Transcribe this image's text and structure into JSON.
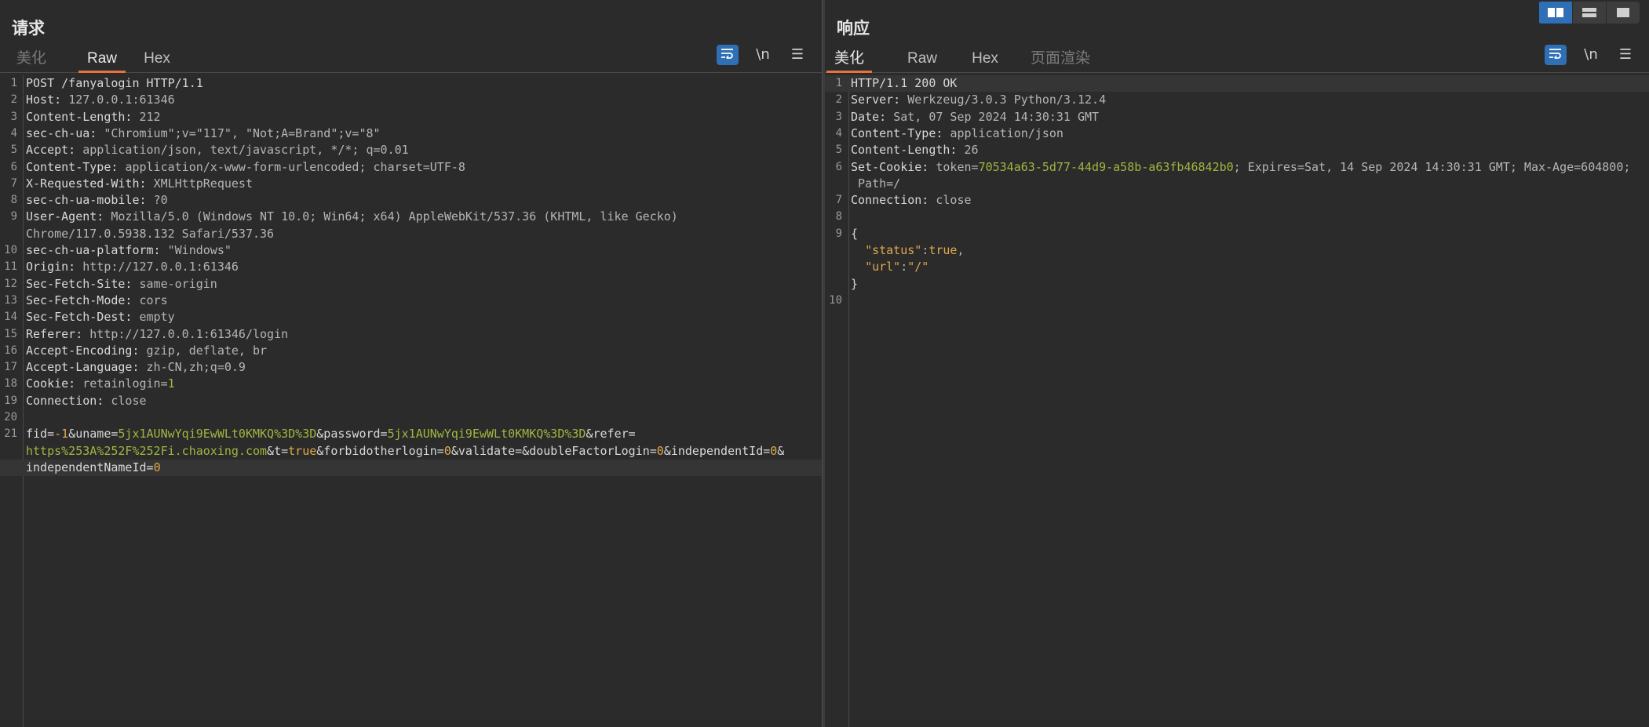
{
  "request": {
    "title": "请求",
    "tabs": [
      "美化",
      "Raw",
      "Hex"
    ],
    "active_tab": "Raw",
    "tools": {
      "wrap_icon": "wrap-icon",
      "newline_label": "\\n",
      "menu_icon": "menu-icon"
    },
    "lines": [
      {
        "n": "1",
        "k": "POST /fanyalogin HTTP/1.1"
      },
      {
        "n": "2",
        "k": "Host: ",
        "v": "127.0.0.1:61346"
      },
      {
        "n": "3",
        "k": "Content-Length: ",
        "v": "212"
      },
      {
        "n": "4",
        "k": "sec-ch-ua: ",
        "v": "\"Chromium\";v=\"117\", \"Not;A=Brand\";v=\"8\""
      },
      {
        "n": "5",
        "k": "Accept: ",
        "v": "application/json, text/javascript, */*; q=0.01"
      },
      {
        "n": "6",
        "k": "Content-Type: ",
        "v": "application/x-www-form-urlencoded; charset=UTF-8"
      },
      {
        "n": "7",
        "k": "X-Requested-With: ",
        "v": "XMLHttpRequest"
      },
      {
        "n": "8",
        "k": "sec-ch-ua-mobile: ",
        "v": "?0"
      },
      {
        "n": "9",
        "k": "User-Agent: ",
        "v": "Mozilla/5.0 (Windows NT 10.0; Win64; x64) AppleWebKit/537.36 (KHTML, like Gecko)"
      },
      {
        "n": "",
        "v": "Chrome/117.0.5938.132 Safari/537.36"
      },
      {
        "n": "10",
        "k": "sec-ch-ua-platform: ",
        "v": "\"Windows\""
      },
      {
        "n": "11",
        "k": "Origin: ",
        "v": "http://127.0.0.1:61346"
      },
      {
        "n": "12",
        "k": "Sec-Fetch-Site: ",
        "v": "same-origin"
      },
      {
        "n": "13",
        "k": "Sec-Fetch-Mode: ",
        "v": "cors"
      },
      {
        "n": "14",
        "k": "Sec-Fetch-Dest: ",
        "v": "empty"
      },
      {
        "n": "15",
        "k": "Referer: ",
        "v": "http://127.0.0.1:61346/login"
      },
      {
        "n": "16",
        "k": "Accept-Encoding: ",
        "v": "gzip, deflate, br"
      },
      {
        "n": "17",
        "k": "Accept-Language: ",
        "v": "zh-CN,zh;q=0.9"
      },
      {
        "n": "18",
        "k": "Cookie: ",
        "v": "retainlogin=",
        "g": "1"
      },
      {
        "n": "19",
        "k": "Connection: ",
        "v": "close"
      },
      {
        "n": "20"
      },
      {
        "n": "21",
        "body": [
          [
            "k",
            "fid="
          ],
          [
            "o",
            "-1"
          ],
          [
            "k",
            "&uname="
          ],
          [
            "g",
            "5jx1AUNwYqi9EwWLt0KMKQ%3D%3D"
          ],
          [
            "k",
            "&password="
          ],
          [
            "g",
            "5jx1AUNwYqi9EwWLt0KMKQ%3D%3D"
          ],
          [
            "k",
            "&refer="
          ]
        ]
      },
      {
        "n": "",
        "body": [
          [
            "g",
            "https%253A%252F%252Fi.chaoxing.com"
          ],
          [
            "k",
            "&t="
          ],
          [
            "o",
            "true"
          ],
          [
            "k",
            "&forbidotherlogin="
          ],
          [
            "o",
            "0"
          ],
          [
            "k",
            "&validate=&doubleFactorLogin="
          ],
          [
            "o",
            "0"
          ],
          [
            "k",
            "&independentId="
          ],
          [
            "o",
            "0"
          ],
          [
            "k",
            "&"
          ]
        ]
      },
      {
        "n": "",
        "body": [
          [
            "k",
            "independentNameId="
          ],
          [
            "o",
            "0"
          ]
        ],
        "hl": true
      }
    ]
  },
  "response": {
    "title": "响应",
    "tabs": [
      "美化",
      "Raw",
      "Hex",
      "页面渲染"
    ],
    "active_tab": "美化",
    "tools": {
      "wrap_icon": "wrap-icon",
      "newline_label": "\\n",
      "menu_icon": "menu-icon"
    },
    "lines": [
      {
        "n": "1",
        "k": "HTTP/1.1 200 OK",
        "hl": true
      },
      {
        "n": "2",
        "k": "Server: ",
        "v": "Werkzeug/3.0.3 Python/3.12.4"
      },
      {
        "n": "3",
        "k": "Date: ",
        "v": "Sat, 07 Sep 2024 14:30:31 GMT"
      },
      {
        "n": "4",
        "k": "Content-Type: ",
        "v": "application/json"
      },
      {
        "n": "5",
        "k": "Content-Length: ",
        "v": "26"
      },
      {
        "n": "6",
        "body": [
          [
            "k",
            "Set-Cookie: "
          ],
          [
            "v",
            "token="
          ],
          [
            "g",
            "70534a63-5d77-44d9-a58b-a63fb46842b0"
          ],
          [
            "v",
            "; Expires=Sat, 14 Sep 2024 14:30:31 GMT; Max-Age=604800;"
          ]
        ]
      },
      {
        "n": "",
        "v": " Path=/"
      },
      {
        "n": "7",
        "k": "Connection: ",
        "v": "close"
      },
      {
        "n": "8"
      },
      {
        "n": "9",
        "k": "{"
      },
      {
        "n": "",
        "body": [
          [
            "v",
            "  "
          ],
          [
            "o",
            "\"status\""
          ],
          [
            "v",
            ":"
          ],
          [
            "o",
            "true"
          ],
          [
            "v",
            ","
          ]
        ]
      },
      {
        "n": "",
        "body": [
          [
            "v",
            "  "
          ],
          [
            "o",
            "\"url\""
          ],
          [
            "v",
            ":"
          ],
          [
            "o",
            "\"/\""
          ]
        ]
      },
      {
        "n": "",
        "k": "}"
      },
      {
        "n": "10"
      }
    ]
  },
  "view_buttons": [
    "split-horizontal-icon",
    "split-vertical-icon",
    "single-pane-icon"
  ],
  "colors": {
    "background": "#2b2b2b",
    "accent": "#e8743b",
    "blue": "#2f6fb5",
    "value_green": "#9fb63f",
    "value_orange": "#e0a94b"
  }
}
